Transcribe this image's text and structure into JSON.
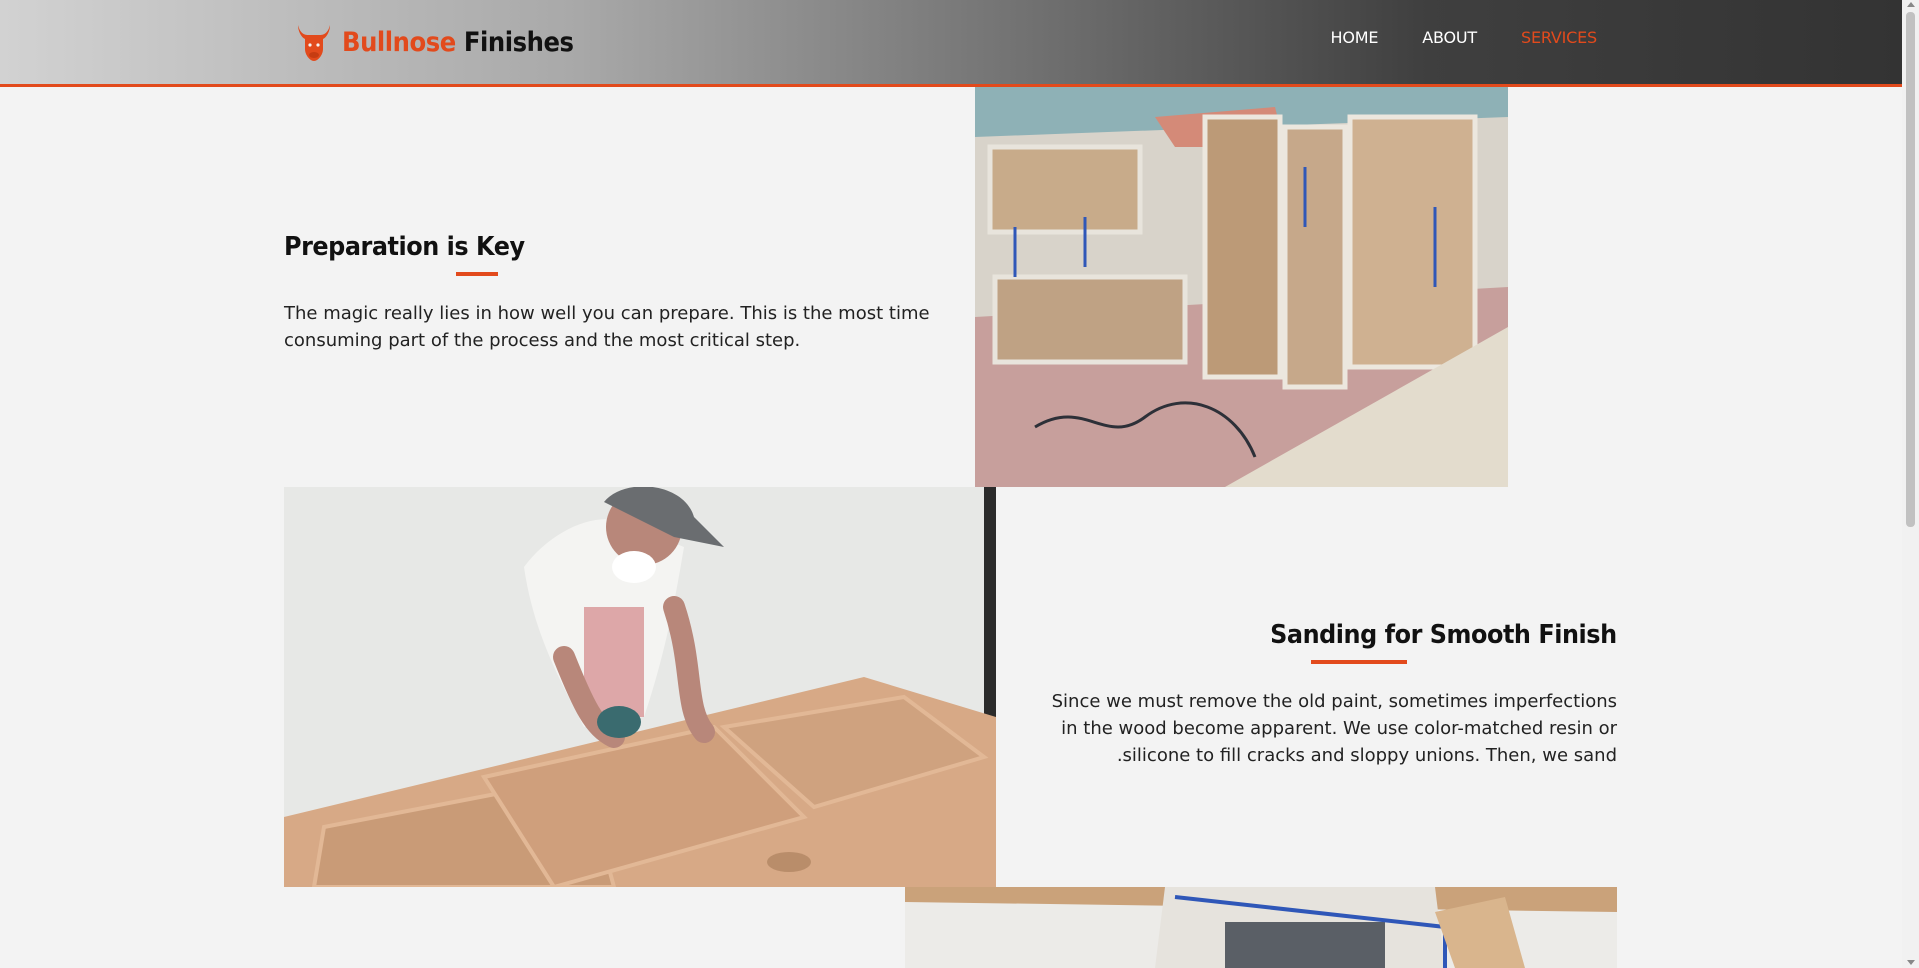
{
  "header": {
    "brand_part1": "Bullnose",
    "brand_part2": "Finishes",
    "nav": [
      {
        "label": "HOME"
      },
      {
        "label": "ABOUT"
      },
      {
        "label": "SERVICES"
      }
    ],
    "accent_color": "#e24a1c"
  },
  "sections": [
    {
      "heading": "Preparation is Key",
      "text": "The magic really lies in how well you can prepare. This is the most time consuming part of the process and the most critical step."
    },
    {
      "heading": "Sanding for Smooth Finish",
      "text_line1": "Since we must remove the old paint, sometimes imperfections",
      "text_line2": "in the wood become apparent. We use color-matched resin or",
      "text_line3": ".silicone to fill cracks and sloppy unions. Then, we sand"
    }
  ]
}
